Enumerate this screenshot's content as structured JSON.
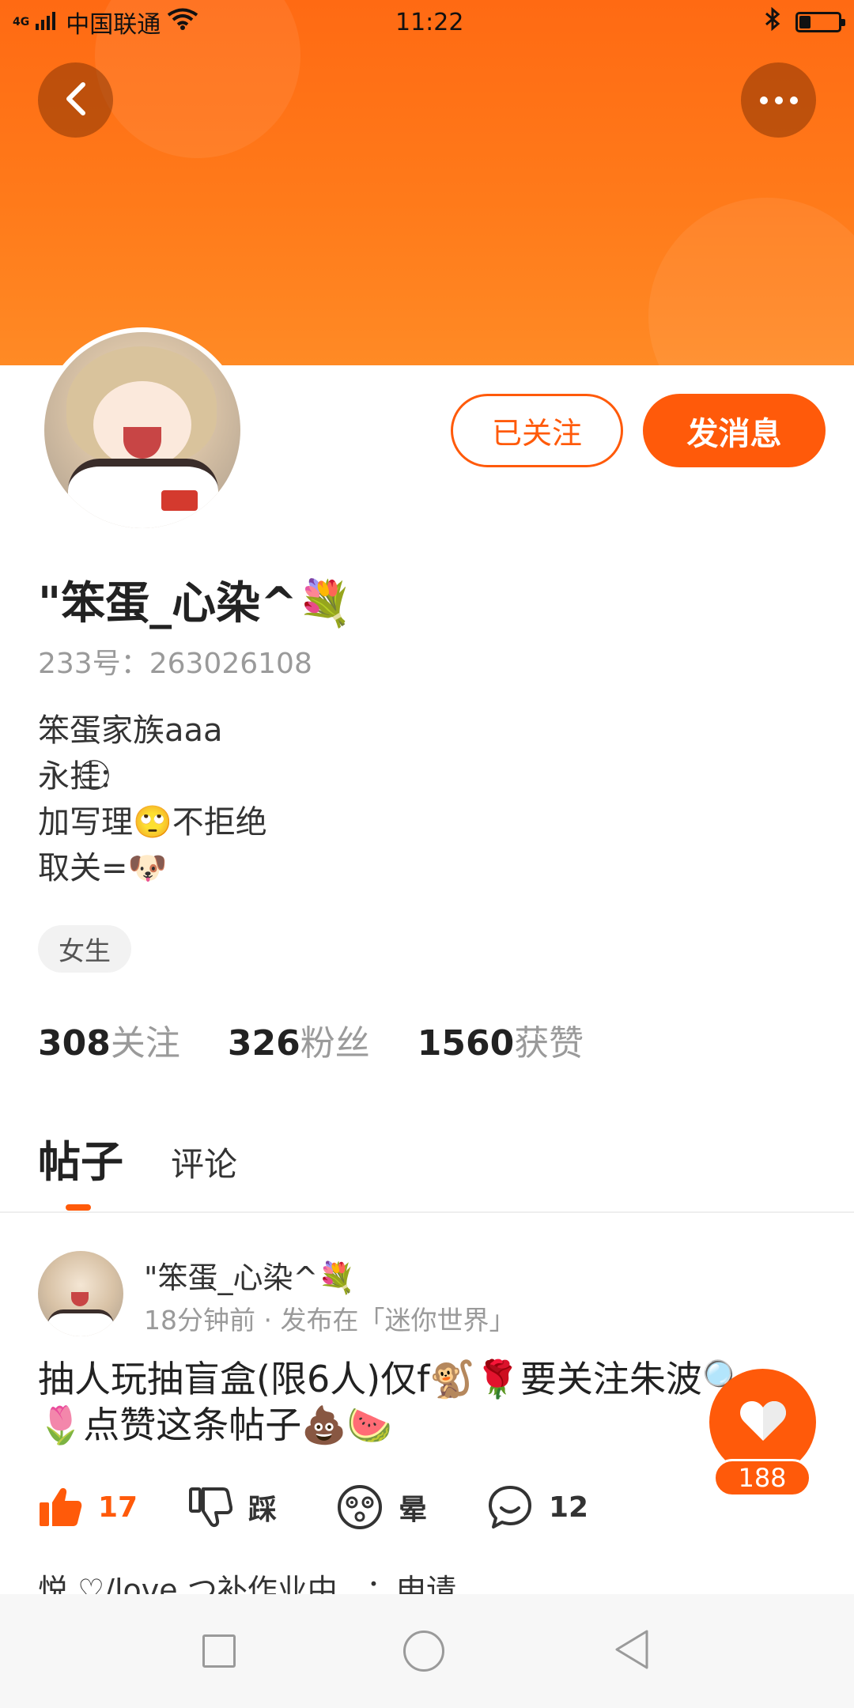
{
  "status_bar": {
    "signal_label": "4G",
    "carrier": "中国联通",
    "time": "11:22"
  },
  "profile": {
    "username": "\"笨蛋_心染^💐",
    "user_id": "233号：263026108",
    "bio": [
      "笨蛋家族aaa",
      "永挂:⃝⃝",
      "加写理🙄不拒绝",
      "取关=🐶"
    ],
    "gender_tag": "女生",
    "follow_button": "已关注",
    "message_button": "发消息"
  },
  "stats": {
    "following_num": "308",
    "following_label": "关注",
    "fans_num": "326",
    "fans_label": "粉丝",
    "likes_num": "1560",
    "likes_label": "获赞"
  },
  "tabs": {
    "posts": "帖子",
    "comments": "评论"
  },
  "post": {
    "author": "\"笨蛋_心染^💐",
    "meta": "18分钟前 · 发布在「迷你世界」",
    "text_line1": "抽人玩抽盲盒(限6人)仅f🐒🌹要关注朱波🔍",
    "text_line2": "🌷点赞这条帖子💩🍉",
    "like_count": "17",
    "dislike_label": "踩",
    "dizzy_label": "晕",
    "comment_count": "12",
    "float_like_count": "188",
    "comment_preview": "悦.♡/love つ补作业中...：申请"
  },
  "colors": {
    "accent": "#ff5a0a",
    "banner": "#ff7a1a"
  }
}
